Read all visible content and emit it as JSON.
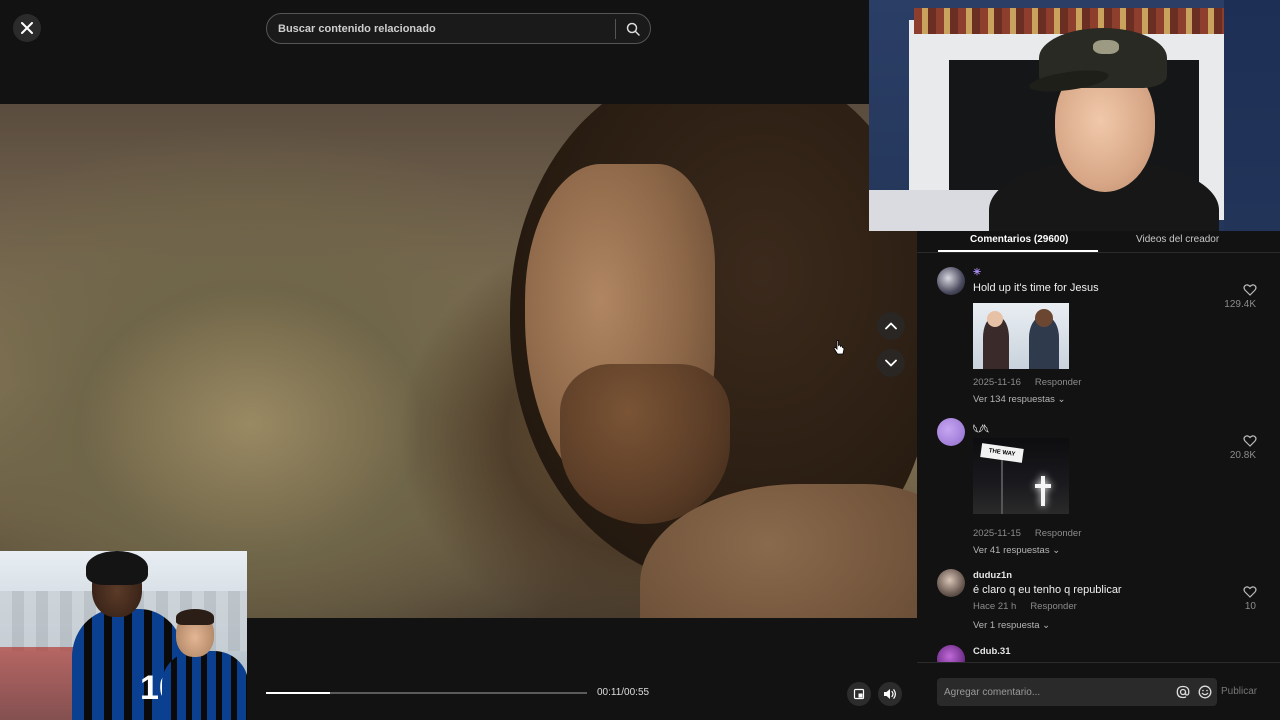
{
  "search": {
    "placeholder": "Buscar contenido relacionado"
  },
  "player": {
    "current_time": "00:11",
    "duration": "00:55",
    "time_display": "00:11/00:55",
    "progress": 0.2
  },
  "overlay_photo": {
    "jersey_number": "10"
  },
  "tabs": [
    {
      "label": "Comentarios (29600)",
      "active": true
    },
    {
      "label": "Videos del creador",
      "active": false
    }
  ],
  "comments": [
    {
      "user": "✳",
      "text": "Hold up it's time for Jesus",
      "date": "2025-11-16",
      "reply_label": "Responder",
      "replies": "Ver 134 respuestas ⌄",
      "likes": "129.4K"
    },
    {
      "user": "𓆩𓆪𓆩",
      "text": "",
      "date": "2025-11-15",
      "reply_label": "Responder",
      "replies": "Ver 41 respuestas ⌄",
      "likes": "20.8K",
      "image_sign": "THE WAY"
    },
    {
      "user": "duduz1n",
      "text": "é claro q eu tenho q republicar",
      "date": "Hace 21 h",
      "reply_label": "Responder",
      "replies": "Ver 1 respuesta ⌄",
      "likes": "10"
    },
    {
      "user": "Cdub.31",
      "text": "",
      "date": "",
      "reply_label": "",
      "replies": "",
      "likes": ""
    }
  ],
  "comment_input": {
    "placeholder": "Agregar comentario..."
  },
  "publish_label": "Publicar",
  "colors": {
    "background": "#121212",
    "accent": "#ffffff",
    "muted": "#8c8c8c"
  }
}
